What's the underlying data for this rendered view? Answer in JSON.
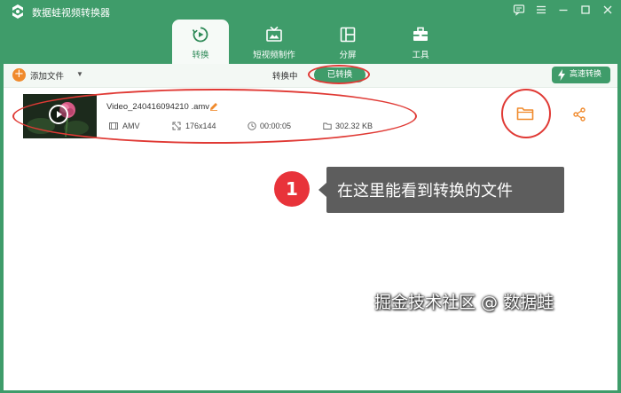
{
  "app": {
    "title": "数据蛙视频转换器"
  },
  "window_controls": [
    "feedback-icon",
    "menu-icon",
    "minimize-icon",
    "maximize-icon",
    "close-icon"
  ],
  "tabs": [
    {
      "label": "转换",
      "icon": "convert-icon",
      "active": true
    },
    {
      "label": "短视频制作",
      "icon": "short-video-icon",
      "active": false
    },
    {
      "label": "分屏",
      "icon": "split-screen-icon",
      "active": false
    },
    {
      "label": "工具",
      "icon": "toolbox-icon",
      "active": false
    }
  ],
  "toolbar": {
    "add_file_label": "添加文件",
    "segment_converting": "转换中",
    "segment_converted": "已转换",
    "speed_label": "高速转换"
  },
  "file": {
    "name": "Video_240416094210 .amv",
    "format": "AMV",
    "resolution": "176x144",
    "duration": "00:00:05",
    "size": "302.32 KB"
  },
  "callout": {
    "step": "1",
    "text": "在这里能看到转换的文件"
  },
  "watermark": "掘金技术社区 @ 数据蛙",
  "colors": {
    "brand_green": "#3f9c6a",
    "accent_orange": "#f08a2c",
    "annotation_red": "#e03a35"
  }
}
